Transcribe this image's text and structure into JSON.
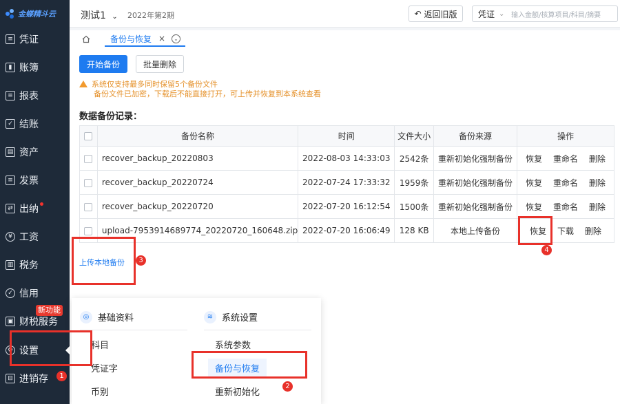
{
  "app": {
    "logo_text": "金蝶精斗云"
  },
  "sidebar": {
    "items": [
      {
        "label": "凭证",
        "icon": "voucher-icon"
      },
      {
        "label": "账簿",
        "icon": "ledger-icon"
      },
      {
        "label": "报表",
        "icon": "report-icon"
      },
      {
        "label": "结账",
        "icon": "closing-icon"
      },
      {
        "label": "资产",
        "icon": "asset-icon"
      },
      {
        "label": "发票",
        "icon": "invoice-icon"
      },
      {
        "label": "出纳",
        "icon": "cashier-icon"
      },
      {
        "label": "工资",
        "icon": "salary-icon"
      },
      {
        "label": "税务",
        "icon": "tax-icon"
      },
      {
        "label": "信用",
        "icon": "credit-icon"
      },
      {
        "label": "财税服务",
        "icon": "tax-service-icon"
      },
      {
        "label": "设置",
        "icon": "settings-icon"
      },
      {
        "label": "进销存",
        "icon": "inventory-icon"
      }
    ],
    "new_badge": "新功能"
  },
  "topbar": {
    "account": "测试1",
    "period": "2022年第2期",
    "old_version_button": "返回旧版",
    "search_type": "凭证",
    "search_placeholder": "输入金额/核算项目/科目/摘要"
  },
  "tabs": {
    "active": "备份与恢复"
  },
  "toolbar": {
    "start_backup": "开始备份",
    "batch_delete": "批量删除"
  },
  "notice": {
    "line1": "系统仅支持最多同时保留5个备份文件",
    "line2": "备份文件已加密，下载后不能直接打开，可上传并恢复到本系统查看"
  },
  "records": {
    "title": "数据备份记录：",
    "columns": [
      "备份名称",
      "时间",
      "文件大小",
      "备份来源",
      "操作"
    ],
    "rows": [
      {
        "name": "recover_backup_20220803",
        "time": "2022-08-03 14:33:03",
        "size": "2542条",
        "source": "重新初始化强制备份",
        "actions": [
          "恢复",
          "重命名",
          "删除"
        ]
      },
      {
        "name": "recover_backup_20220724",
        "time": "2022-07-24 17:33:32",
        "size": "1959条",
        "source": "重新初始化强制备份",
        "actions": [
          "恢复",
          "重命名",
          "删除"
        ]
      },
      {
        "name": "recover_backup_20220720",
        "time": "2022-07-20 16:12:54",
        "size": "1500条",
        "source": "重新初始化强制备份",
        "actions": [
          "恢复",
          "重命名",
          "删除"
        ]
      },
      {
        "name": "upload-7953914689774_20220720_160648.zip",
        "time": "2022-07-20 16:06:49",
        "size": "128 KB",
        "source": "本地上传备份",
        "actions": [
          "恢复",
          "下载",
          "删除"
        ]
      }
    ]
  },
  "upload_link": "上传本地备份",
  "popup": {
    "col1": {
      "title": "基础资料",
      "items": [
        "科目",
        "凭证字",
        "币别"
      ]
    },
    "col2": {
      "title": "系统设置",
      "items": [
        "系统参数",
        "备份与恢复",
        "重新初始化"
      ]
    }
  },
  "annotations": [
    "1",
    "2",
    "3",
    "4"
  ]
}
